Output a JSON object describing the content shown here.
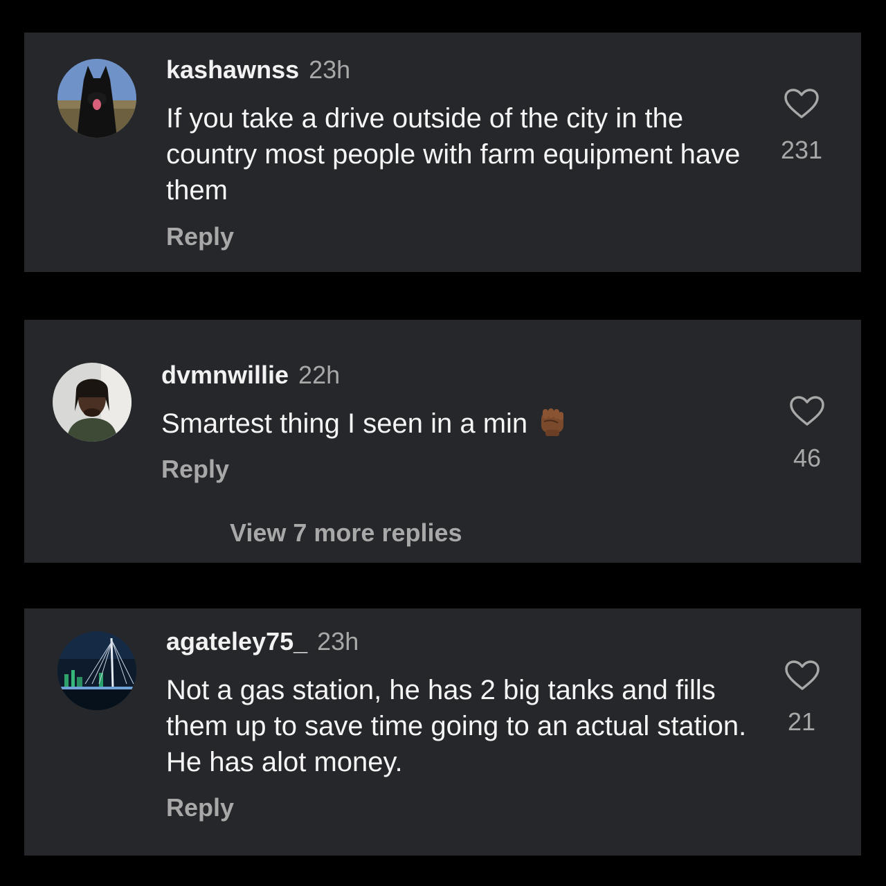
{
  "comments": [
    {
      "username": "kashawnss",
      "time": "23h",
      "text": "If you take a drive outside of the city in the country most people with farm equipment have them",
      "reply_label": "Reply",
      "likes": "231",
      "avatar": "dog-avatar"
    },
    {
      "username": "dvmnwillie",
      "time": "22h",
      "text": "Smartest thing I seen in a min",
      "emoji": "raised-fist-medium-dark-skin",
      "reply_label": "Reply",
      "likes": "46",
      "view_more_label": "View 7 more replies",
      "avatar": "person-avatar"
    },
    {
      "username": "agateley75_",
      "time": "23h",
      "text": "Not a gas station, he has 2 big tanks and fills them up to save time going to an actual station. He has alot money.",
      "reply_label": "Reply",
      "likes": "21",
      "avatar": "city-bridge-avatar"
    }
  ],
  "colors": {
    "background": "#000000",
    "card": "#25272b",
    "primary_text": "#f5f5f5",
    "secondary_text": "#a8a8a8"
  },
  "icons": {
    "like": "heart-outline-icon"
  }
}
